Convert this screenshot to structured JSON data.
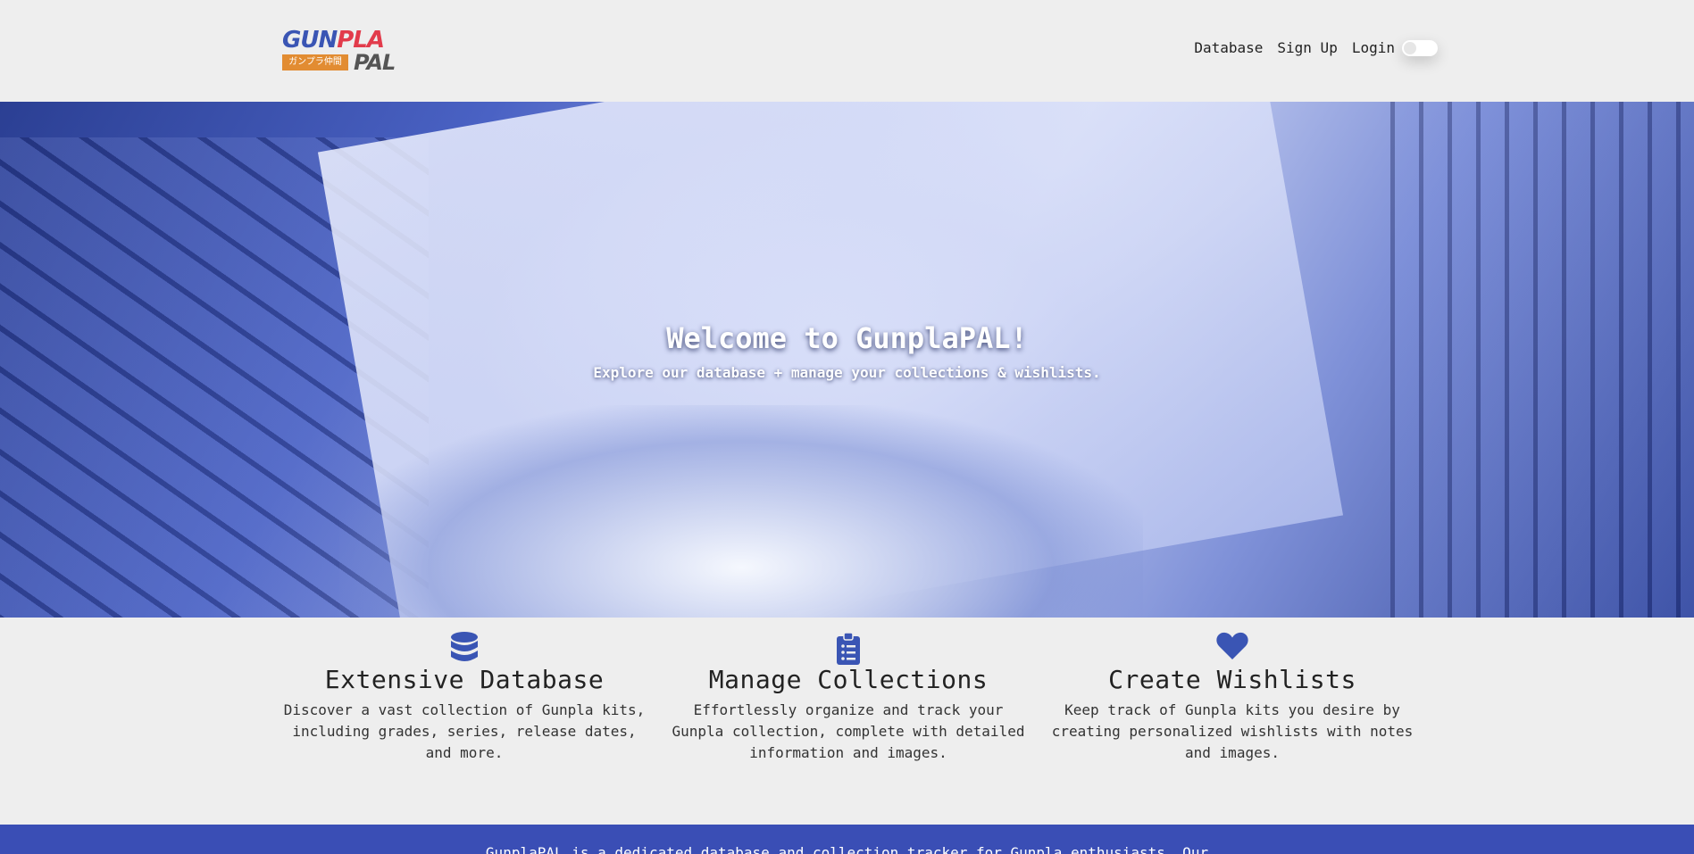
{
  "header": {
    "logo_top_left": "GUN",
    "logo_top_right": "PLA",
    "logo_japanese": "ガンプラ仲間",
    "logo_bottom": "PAL",
    "nav": [
      {
        "label": "Database"
      },
      {
        "label": "Sign Up"
      },
      {
        "label": "Login"
      }
    ],
    "theme_toggle_on": false
  },
  "hero": {
    "title": "Welcome to GunplaPAL!",
    "subtitle": "Explore our database + manage your collections & wishlists."
  },
  "features": [
    {
      "icon": "database-icon",
      "title": "Extensive Database",
      "text": "Discover a vast collection of Gunpla kits, including grades, series, release dates, and more."
    },
    {
      "icon": "clipboard-list-icon",
      "title": "Manage Collections",
      "text": "Effortlessly organize and track your Gunpla collection, complete with detailed information and images."
    },
    {
      "icon": "heart-icon",
      "title": "Create Wishlists",
      "text": "Keep track of Gunpla kits you desire by creating personalized wishlists with notes and images."
    }
  ],
  "footer": {
    "text": "GunplaPAL is a dedicated database and collection tracker for Gunpla enthusiasts. Our"
  },
  "colors": {
    "accent": "#3a55b4",
    "footer_bg": "#3a4eb5",
    "logo_red": "#e23b4b",
    "logo_orange": "#e28c32"
  }
}
